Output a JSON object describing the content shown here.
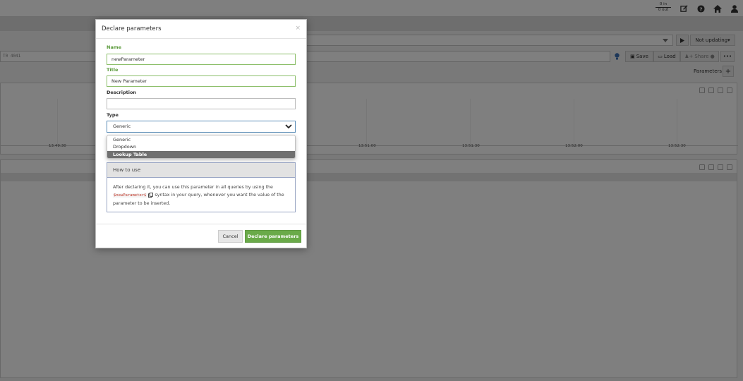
{
  "topbar": {
    "in_label": "0 in",
    "out_label": "0 out"
  },
  "toolbar": {
    "not_updating_label": "Not updating",
    "query_text": "T0 4041",
    "save_label": "Save",
    "load_label": "Load",
    "share_label": "Share",
    "parameters_label": "Parameters"
  },
  "chart": {
    "ticks": [
      "13:49:30",
      "13:51:00",
      "13:51:30",
      "13:52:00",
      "13:52:30"
    ]
  },
  "modal": {
    "title": "Declare parameters",
    "close": "×",
    "name_label": "Name",
    "name_value": "newParameter",
    "title_label": "Title",
    "title_value": "New Parameter",
    "description_label": "Description",
    "description_value": "",
    "type_label": "Type",
    "type_value": "Generic",
    "type_options": [
      "Generic",
      "Dropdown",
      "Lookup Table"
    ],
    "howto_title": "How to use",
    "howto_text_1": "After declaring it, you can use this parameter in all queries by using the",
    "howto_code": "$newParameter$",
    "howto_text_2": "syntax in your query, whenever you want the value of the parameter to be inserted.",
    "cancel_label": "Cancel",
    "declare_label": "Declare parameters"
  }
}
